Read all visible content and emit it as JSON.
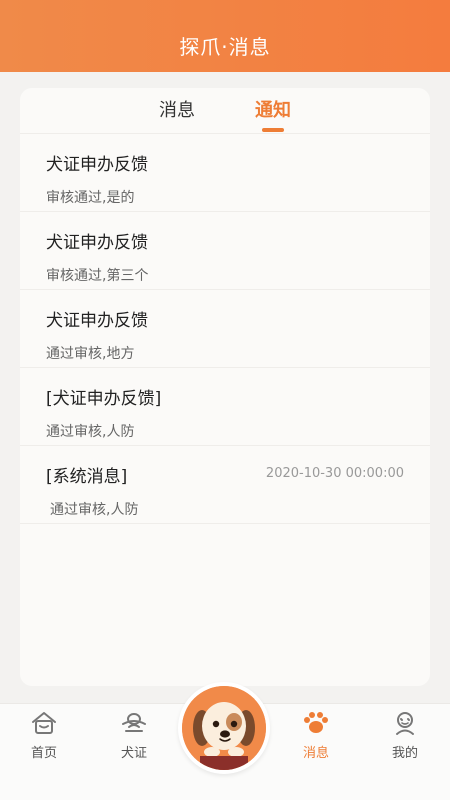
{
  "header": {
    "title": "探爪·消息"
  },
  "tabs": [
    {
      "label": "消息",
      "active": false
    },
    {
      "label": "通知",
      "active": true
    }
  ],
  "notifications": [
    {
      "title": "犬证申办反馈",
      "subtitle": "审核通过,是的",
      "time": ""
    },
    {
      "title": "犬证申办反馈",
      "subtitle": "审核通过,第三个",
      "time": ""
    },
    {
      "title": "犬证申办反馈",
      "subtitle": "通过审核,地方",
      "time": ""
    },
    {
      "title": "[犬证申办反馈]",
      "subtitle": "通过审核,人防",
      "time": ""
    },
    {
      "title": "[系统消息]",
      "subtitle": "通过审核,人防",
      "time": "2020-10-30 00:00:00"
    }
  ],
  "tabbar": {
    "items": [
      {
        "label": "首页",
        "icon": "home-icon"
      },
      {
        "label": "犬证",
        "icon": "dog-license-icon"
      },
      {
        "label": "消息",
        "icon": "paw-icon",
        "active": true
      },
      {
        "label": "我的",
        "icon": "profile-icon"
      }
    ],
    "center_icon": "dog-avatar-icon"
  },
  "colors": {
    "accent": "#ee7d35",
    "header": "#f47c3e"
  }
}
